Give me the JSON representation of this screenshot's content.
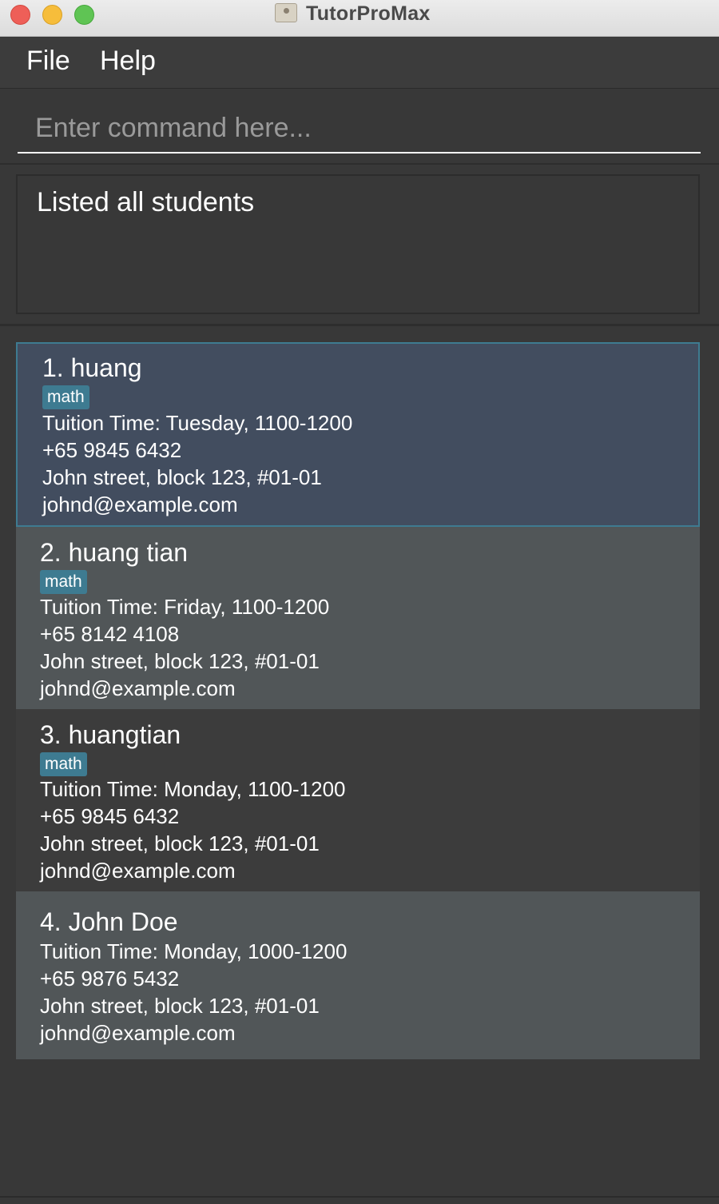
{
  "window": {
    "title": "TutorProMax"
  },
  "menu": {
    "file": "File",
    "help": "Help"
  },
  "command": {
    "placeholder": "Enter command here..."
  },
  "result": {
    "message": "Listed all students"
  },
  "students": [
    {
      "name": "1. huang",
      "tag": "math",
      "tuition": "Tuition Time: Tuesday, 1100-1200",
      "phone": "+65 9845 6432",
      "address": "John street, block 123, #01-01",
      "email": "johnd@example.com"
    },
    {
      "name": "2. huang tian",
      "tag": "math",
      "tuition": "Tuition Time: Friday, 1100-1200",
      "phone": "+65 8142 4108",
      "address": "John street, block 123, #01-01",
      "email": "johnd@example.com"
    },
    {
      "name": "3. huangtian",
      "tag": "math",
      "tuition": "Tuition Time: Monday, 1100-1200",
      "phone": "+65 9845 6432",
      "address": "John street, block 123, #01-01",
      "email": "johnd@example.com"
    },
    {
      "name": "4. John Doe",
      "tuition": "Tuition Time: Monday, 1000-1200",
      "phone": "+65 9876 5432",
      "address": "John street, block 123, #01-01",
      "email": "johnd@example.com"
    }
  ],
  "colors": {
    "tag": "#3e7b91",
    "selected": "#424d5f",
    "row_alt": "#515658",
    "background": "#383838"
  }
}
